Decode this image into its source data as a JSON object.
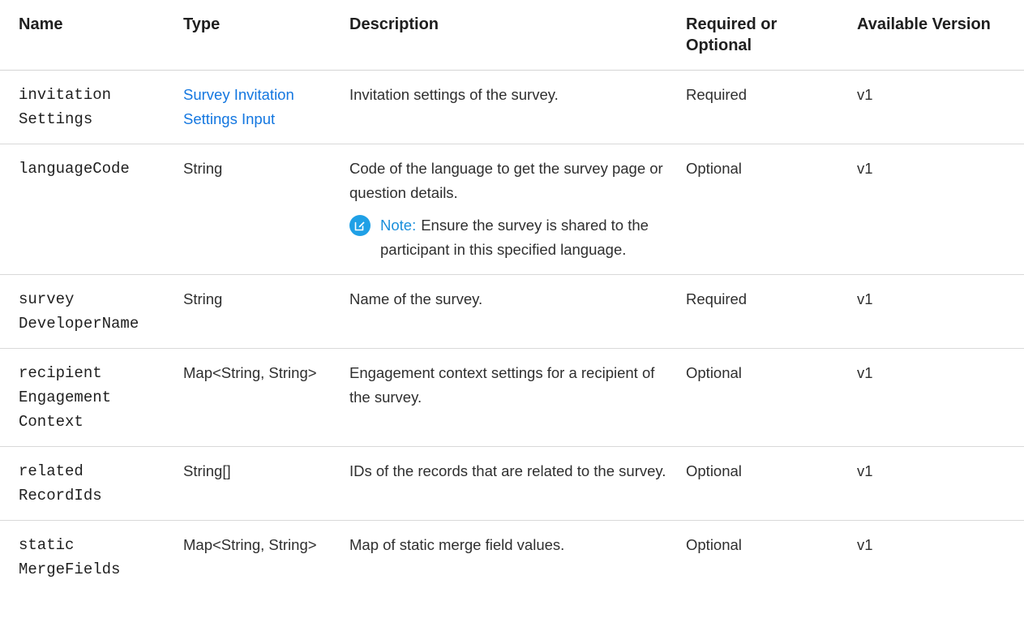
{
  "header": {
    "name": "Name",
    "type": "Type",
    "description": "Description",
    "required": "Required or Optional",
    "version": "Available Version"
  },
  "rows": [
    {
      "name": "invitation\nSettings",
      "type": "Survey Invitation Settings Input",
      "description": "Invitation settings of the survey.",
      "required": "Required",
      "version": "v1"
    },
    {
      "name": "languageCode",
      "type": "String",
      "description": "Code of the language to get the survey page or question details.",
      "note_label": "Note:",
      "note_text": "Ensure the survey is shared to the participant in this specified language.",
      "required": "Optional",
      "version": "v1"
    },
    {
      "name": "survey\nDeveloperName",
      "type": "String",
      "description": "Name of the survey.",
      "required": "Required",
      "version": "v1"
    },
    {
      "name": "recipient\nEngagement\nContext",
      "type": "Map<String, String>",
      "description": "Engagement context settings for a recipient of the survey.",
      "required": "Optional",
      "version": "v1"
    },
    {
      "name": "related\nRecordIds",
      "type": "String[]",
      "description": "IDs of the records that are related to the survey.",
      "required": "Optional",
      "version": "v1"
    },
    {
      "name": "static\nMergeFields",
      "type": "Map<String, String>",
      "description": "Map of static merge field values.",
      "required": "Optional",
      "version": "v1"
    }
  ],
  "colors": {
    "link": "#1477e0",
    "note_accent": "#1fa0e6"
  },
  "icons": {
    "note": "edit-note-icon"
  }
}
